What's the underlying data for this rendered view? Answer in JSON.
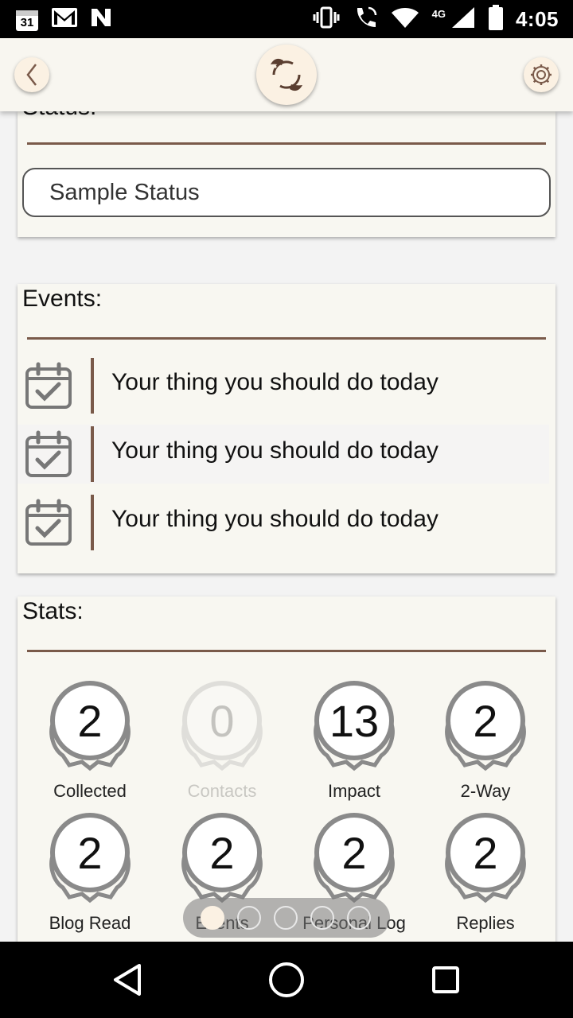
{
  "status_bar": {
    "time": "4:05",
    "network": "4G",
    "calendar_day": "31",
    "icons": [
      "calendar-icon",
      "gmail-icon",
      "n-icon",
      "vibrate-icon",
      "wifi-call-icon",
      "wifi-icon",
      "signal-icon",
      "battery-icon"
    ]
  },
  "app_bar": {
    "icons": [
      "back-chevron-icon",
      "sync-logo-icon",
      "gear-icon"
    ]
  },
  "status_section": {
    "title": "Status:",
    "input_value": "Sample Status"
  },
  "events_section": {
    "title": "Events:",
    "items": [
      {
        "text": "Your thing you should do today"
      },
      {
        "text": "Your thing you should do today"
      },
      {
        "text": "Your thing you should do today"
      }
    ]
  },
  "stats_section": {
    "title": "Stats:",
    "items": [
      {
        "value": "2",
        "label": "Collected"
      },
      {
        "value": "0",
        "label": "Contacts"
      },
      {
        "value": "13",
        "label": "Impact"
      },
      {
        "value": "2",
        "label": "2-Way"
      },
      {
        "value": "2",
        "label": "Blog Read"
      },
      {
        "value": "2",
        "label": "Events"
      },
      {
        "value": "2",
        "label": "Personal Log"
      },
      {
        "value": "2",
        "label": "Replies"
      }
    ]
  },
  "pager": {
    "page_count": 5,
    "current_page": 1
  },
  "colors": {
    "accent_brown": "#7a5a4a",
    "card_bg": "#f8f7f1",
    "button_cream": "#fbf1e3"
  }
}
